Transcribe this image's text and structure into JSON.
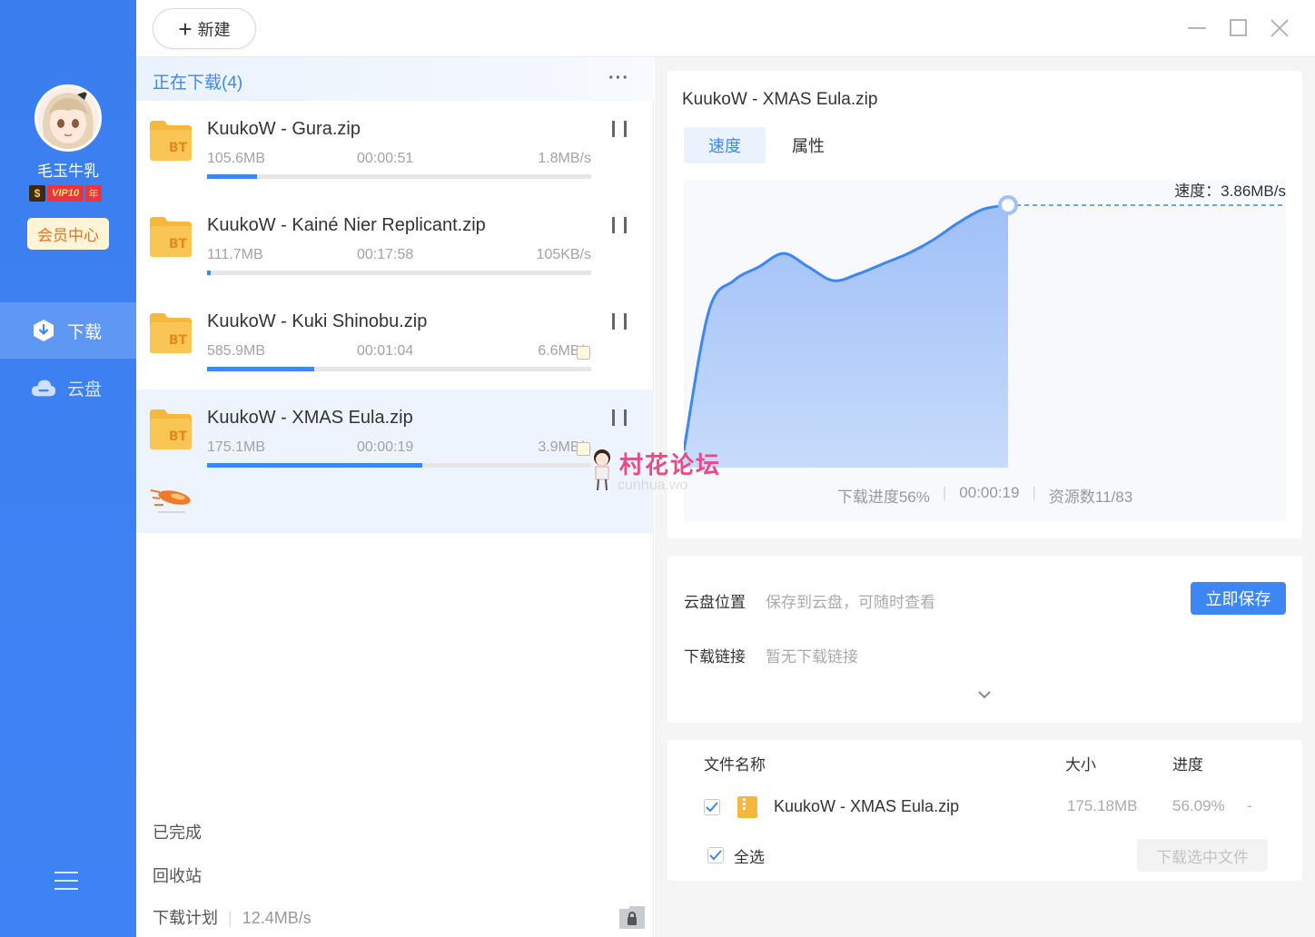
{
  "sidebar": {
    "username": "毛玉牛乳",
    "vip_s": "$",
    "vip_level": "VIP10",
    "vip_year": "年",
    "member_center": "会员中心",
    "nav": [
      {
        "label": "下载",
        "icon": "download-icon",
        "active": true
      },
      {
        "label": "云盘",
        "icon": "cloud-icon",
        "active": false
      }
    ]
  },
  "toolbar": {
    "new_label": "新建",
    "plus": "+"
  },
  "list": {
    "header": "正在下载(4)",
    "more": "···",
    "tasks": [
      {
        "name": "KuukoW - Gura.zip",
        "size": "105.6MB",
        "time": "00:00:51",
        "speed": "1.8MB/s",
        "progress": 0.13,
        "accelerated": false
      },
      {
        "name": "KuukoW - Kainé Nier Replicant.zip",
        "size": "111.7MB",
        "time": "00:17:58",
        "speed": "105KB/s",
        "progress": 0.01,
        "accelerated": false
      },
      {
        "name": "KuukoW - Kuki Shinobu.zip",
        "size": "585.9MB",
        "time": "00:01:04",
        "speed": "6.6MB/s",
        "progress": 0.28,
        "accelerated": true
      },
      {
        "name": "KuukoW - XMAS Eula.zip",
        "size": "175.1MB",
        "time": "00:00:19",
        "speed": "3.9MB/s",
        "progress": 0.56,
        "accelerated": true
      }
    ],
    "folder_badge": "BT",
    "completed": "已完成",
    "recycle": "回收站",
    "plan_label": "下载计划",
    "plan_speed": "12.4MB/s"
  },
  "detail": {
    "title": "KuukoW - XMAS Eula.zip",
    "tab_speed": "速度",
    "tab_props": "属性",
    "speed_label": "速度：3.86MB/s",
    "stat_progress": "下载进度56%",
    "stat_time": "00:00:19",
    "stat_sources": "资源数11/83"
  },
  "chart_data": {
    "type": "area",
    "title": "",
    "xlabel": "",
    "ylabel": "",
    "series": [
      {
        "values": [
          0.25,
          2.3,
          2.75,
          2.95,
          3.15,
          2.95,
          2.75,
          2.85,
          3.0,
          3.15,
          3.35,
          3.6,
          3.8,
          3.86
        ]
      }
    ],
    "current_value": 3.86,
    "unit": "MB/s",
    "color": "#3d87f5"
  },
  "cloud": {
    "location_label": "云盘位置",
    "location_value": "保存到云盘，可随时查看",
    "save_button": "立即保存",
    "link_label": "下载链接",
    "link_value": "暂无下载链接"
  },
  "files": {
    "col_name": "文件名称",
    "col_size": "大小",
    "col_progress": "进度",
    "rows": [
      {
        "name": "KuukoW - XMAS Eula.zip",
        "size": "175.18MB",
        "progress": "56.09%",
        "extra": "-",
        "checked": true
      }
    ],
    "select_all": "全选",
    "download_selected": "下载选中文件"
  },
  "watermark": {
    "text": "村花论坛",
    "sub": "cunhua.wo"
  },
  "colors": {
    "accent": "#3d87f5",
    "sidebar": "#3b7ef0",
    "member": "#e6731c"
  }
}
